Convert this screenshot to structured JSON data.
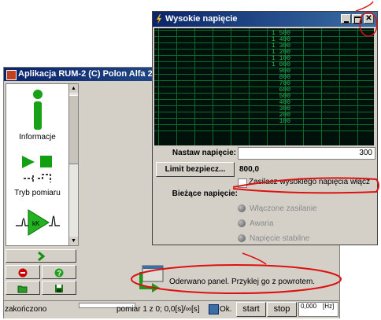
{
  "main_window": {
    "title": "Aplikacja RUM-2 (C) Polon Alfa 2007-",
    "left_panel": {
      "items": [
        {
          "label": "Informacje",
          "icon": "info-icon"
        },
        {
          "label": "Tryb pomiaru",
          "icon": "mode-play-stop-icon"
        },
        {
          "label": "",
          "icon": "amplifier-pulse-icon"
        }
      ]
    },
    "buttons": {
      "next": "chevron-right-icon",
      "stop": "power-stop-icon",
      "help": "help-icon",
      "open": "open-folder-icon",
      "save": "floppy-save-icon"
    },
    "notice": "Oderwano panel. Przyklej go z powrotem.",
    "status": {
      "state": "zakończono",
      "pomiar": "pomiar 1 z 0; 0,0[s]/∞[s]",
      "ok_label": "Ok.",
      "start_label": "start",
      "stop_label": "stop",
      "frequency": "0,000",
      "frequency_unit": "[Hz]"
    }
  },
  "dialog": {
    "title": "Wysokie napięcie",
    "scale_labels": [
      "1 500",
      "1 400",
      "1 300",
      "1 200",
      "1 100",
      "1 000",
      "900",
      "800",
      "700",
      "600",
      "500",
      "400",
      "300",
      "200",
      "100"
    ],
    "set_voltage_label": "Nastaw napięcie:",
    "set_voltage_value": "300",
    "limit_button": "Limit bezpiecz...",
    "limit_value": "800,0",
    "hv_checkbox_label": "Zasilacz wysokiego napięcia włącz",
    "hv_checkbox_checked": false,
    "current_voltage_label": "Bieżące napięcie:",
    "indicators": [
      "Włączone zasilanie",
      "Awaria",
      "Napięcie stabilne"
    ],
    "colors": {
      "title_bar": "#0a246a",
      "screen_bg": "#00100a",
      "grid": "#0a6a30",
      "annotation": "#dd1111"
    }
  }
}
